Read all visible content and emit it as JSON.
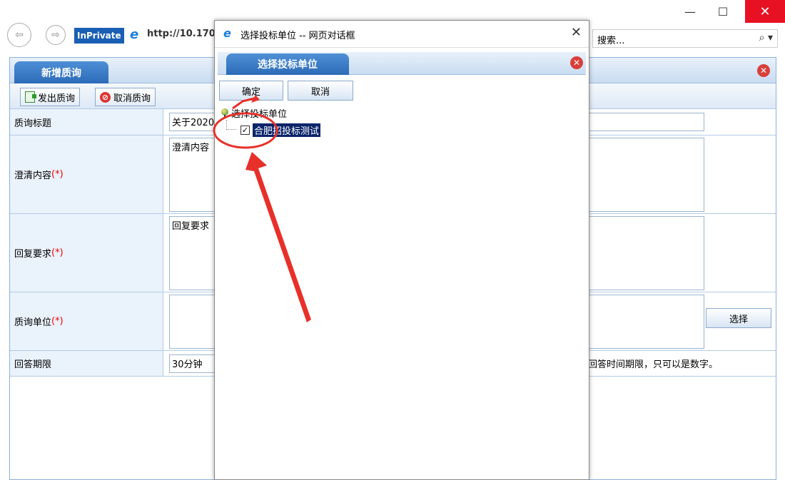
{
  "browser": {
    "inprivate_label": "InPrivate",
    "address": "http://10.170",
    "search_placeholder": "搜索...",
    "minimize": "—",
    "maximize": "☐",
    "close": "✕",
    "search_icon": "⌕ ▾"
  },
  "panel": {
    "tab_label": "新增质询",
    "close_icon": "✕",
    "toolbar": {
      "send_label": "发出质询",
      "cancel_label": "取消质询"
    }
  },
  "form": {
    "title_label": "质询标题",
    "title_value": "关于2020",
    "content_label": "澄清内容",
    "content_value": "澄清内容",
    "reply_label": "回复要求",
    "reply_value": "回复要求",
    "unit_label": "质询单位",
    "unit_value": "",
    "select_button": "选择",
    "deadline_label": "回答期限",
    "deadline_value": "30分钟",
    "deadline_hint": "回答时间期限，只可以是数字。",
    "required_mark": "(*)"
  },
  "dialog": {
    "window_title": "选择投标单位 -- 网页对话框",
    "window_close": "✕",
    "tab_label": "选择投标单位",
    "close_icon": "✕",
    "ok_button": "确定",
    "cancel_button": "取消",
    "tree_root": "选择投标单位",
    "tree_child": "合肥招投标测试",
    "checkmark": "✓"
  },
  "colors": {
    "tab_blue": "#2c6bb8",
    "annotation_red": "#e8302a",
    "selection_navy": "#0a246a"
  }
}
